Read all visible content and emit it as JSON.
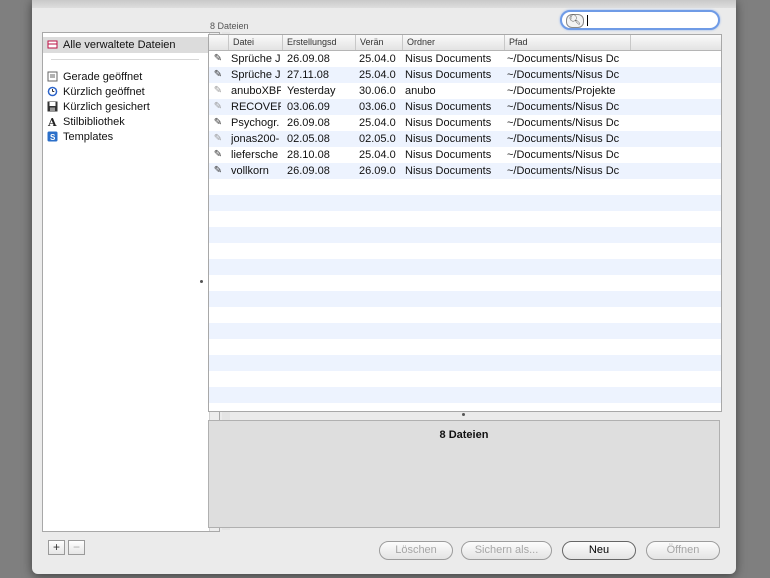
{
  "count_label": "8 Dateien",
  "search": {
    "value": ""
  },
  "sidebar": {
    "selected": "Alle verwaltete Dateien",
    "items": [
      {
        "label": "Gerade geöffnet",
        "icon": "document-list-icon"
      },
      {
        "label": "Kürzlich geöffnet",
        "icon": "clock-icon"
      },
      {
        "label": "Kürzlich gesichert",
        "icon": "floppy-disk-icon"
      },
      {
        "label": "Stilbibliothek",
        "icon": "style-library-icon"
      },
      {
        "label": "Templates",
        "icon": "template-icon"
      }
    ]
  },
  "table": {
    "columns": [
      "Datei",
      "Erstellungsd",
      "Verän",
      "Ordner",
      "Pfad"
    ],
    "rows": [
      {
        "datei": "Sprüche J",
        "erstellt": "26.09.08",
        "geaendert": "25.04.0",
        "ordner": "Nisus Documents",
        "pfad": "~/Documents/Nisus Dc"
      },
      {
        "datei": "Sprüche J",
        "erstellt": "27.11.08",
        "geaendert": "25.04.0",
        "ordner": "Nisus Documents",
        "pfad": "~/Documents/Nisus Dc"
      },
      {
        "datei": "anuboXBF",
        "erstellt": "Yesterday",
        "geaendert": "30.06.0",
        "ordner": "anubo",
        "pfad": "~/Documents/Projekte"
      },
      {
        "datei": "RECOVERI",
        "erstellt": "03.06.09",
        "geaendert": "03.06.0",
        "ordner": "Nisus Documents",
        "pfad": "~/Documents/Nisus Dc"
      },
      {
        "datei": "Psychogr.",
        "erstellt": "26.09.08",
        "geaendert": "25.04.0",
        "ordner": "Nisus Documents",
        "pfad": "~/Documents/Nisus Dc"
      },
      {
        "datei": "jonas200-",
        "erstellt": "02.05.08",
        "geaendert": "02.05.0",
        "ordner": "Nisus Documents",
        "pfad": "~/Documents/Nisus Dc"
      },
      {
        "datei": "liefersche",
        "erstellt": "28.10.08",
        "geaendert": "25.04.0",
        "ordner": "Nisus Documents",
        "pfad": "~/Documents/Nisus Dc"
      },
      {
        "datei": "vollkorn",
        "erstellt": "26.09.08",
        "geaendert": "26.09.0",
        "ordner": "Nisus Documents",
        "pfad": "~/Documents/Nisus Dc"
      }
    ]
  },
  "info": {
    "title": "8 Dateien"
  },
  "buttons": {
    "add": "+",
    "remove": "−",
    "delete": "Löschen",
    "save_as": "Sichern als...",
    "new": "Neu",
    "open": "Öffnen"
  },
  "colors": {
    "accent": "#6f9be6",
    "stripe": "#edf3fe"
  }
}
